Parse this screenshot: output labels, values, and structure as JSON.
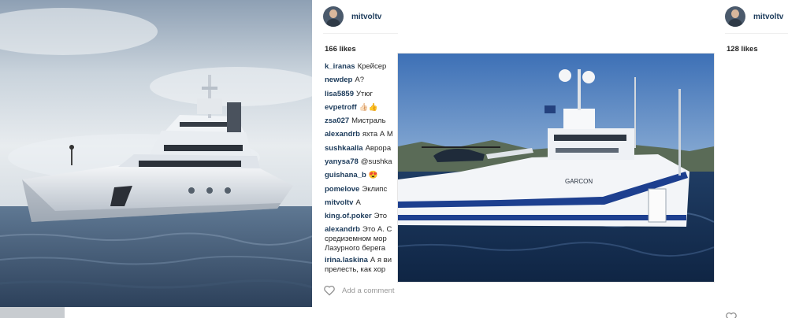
{
  "posts": [
    {
      "username": "mitvoltv",
      "likes": "166 likes",
      "comments": [
        {
          "user": "k_iranas",
          "text": "Крейсер"
        },
        {
          "user": "newdep",
          "text": "A?"
        },
        {
          "user": "lisa5859",
          "text": "Утюг"
        },
        {
          "user": "evpetroff",
          "text": "👍🏻👍"
        },
        {
          "user": "zsa027",
          "text": "Мистраль"
        },
        {
          "user": "alexandrb",
          "text": "яхта А M"
        },
        {
          "user": "sushkaalla",
          "text": "Аврора"
        },
        {
          "user": "yanysa78",
          "text": "@sushka"
        },
        {
          "user": "guishana_b",
          "text": "😍"
        },
        {
          "user": "pomelove",
          "text": "Эклипс"
        },
        {
          "user": "mitvoltv",
          "text": "А"
        },
        {
          "user": "king.of.poker",
          "text": "Это"
        },
        {
          "user": "alexandrb",
          "text": "Это А. С средиземном мор Лазурного берега"
        },
        {
          "user": "irina.laskina",
          "text": "А я ви прелесть, как хор"
        }
      ],
      "add_comment_placeholder": "Add a comment"
    },
    {
      "username": "mitvoltv",
      "likes": "128 likes",
      "yacht_hull_text": "GARCON"
    }
  ],
  "colors": {
    "link": "#1b3a5a",
    "text": "#262626",
    "muted": "#999999",
    "hull_stripe": "#1d3f8f"
  }
}
